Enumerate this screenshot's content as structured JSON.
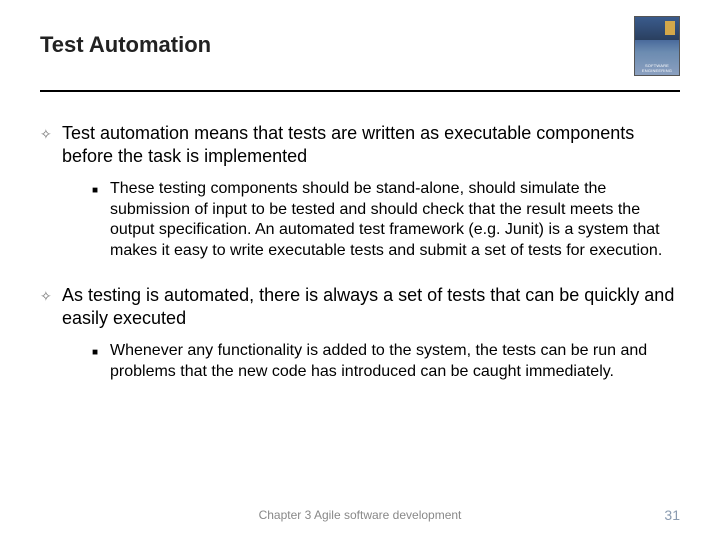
{
  "header": {
    "title": "Test Automation",
    "cover_label": "SOFTWARE ENGINEERING"
  },
  "bullets": [
    {
      "text": "Test automation means that tests are written as executable components before the task is implemented",
      "sub": [
        "These testing components should be stand-alone, should simulate the submission of input to be tested and should check that the result meets the output specification. An automated test framework (e.g. Junit) is a system that makes it easy to write executable tests and submit a set of tests for execution."
      ]
    },
    {
      "text": "As testing is automated, there is always a set of tests that can be quickly and easily executed",
      "sub": [
        "Whenever any functionality is added to the system, the tests can be run and problems that the new code has introduced can be caught immediately."
      ]
    }
  ],
  "footer": {
    "center": "Chapter 3 Agile software development",
    "page": "31"
  }
}
